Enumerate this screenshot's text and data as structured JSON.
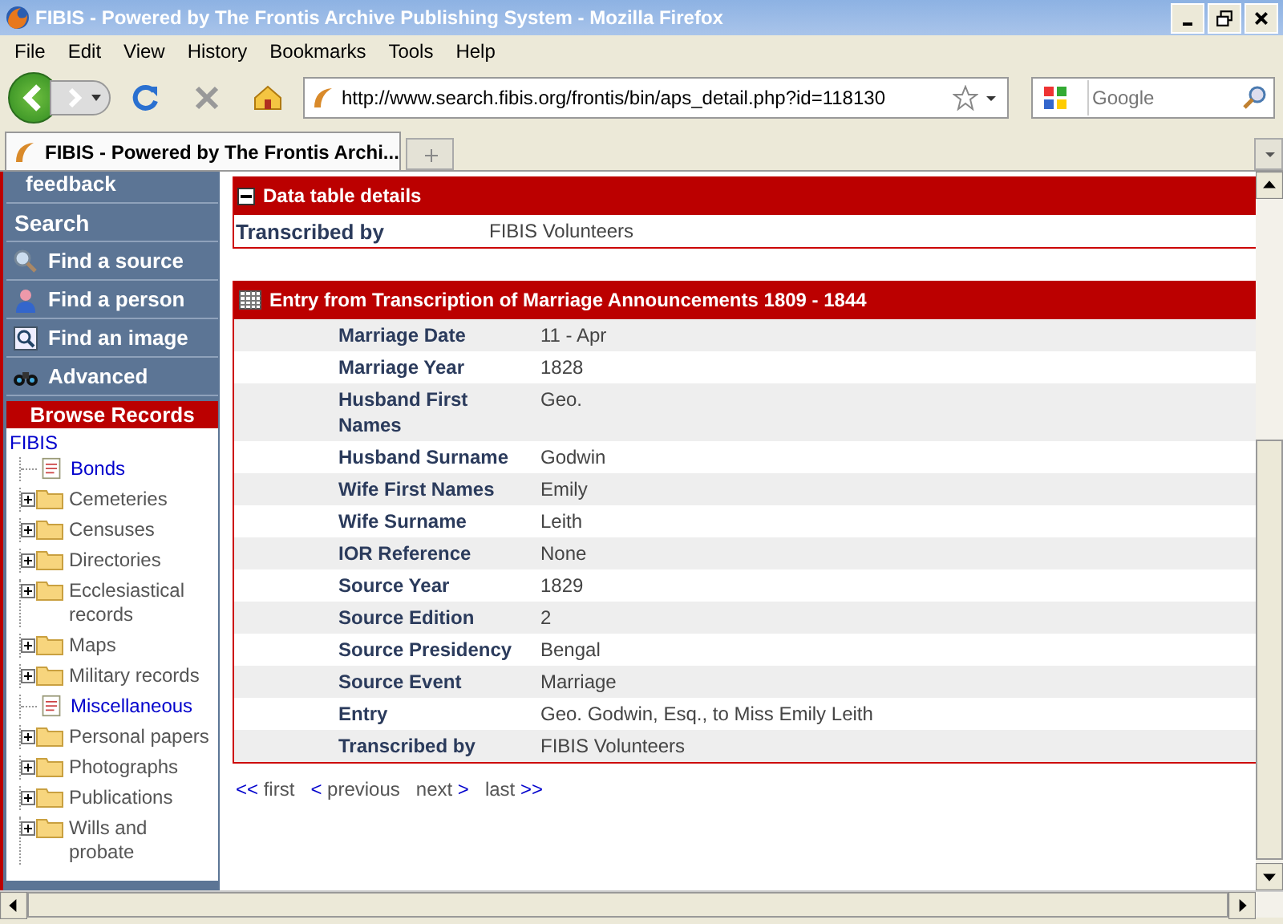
{
  "window": {
    "title": "FIBIS - Powered by The Frontis Archive Publishing System - Mozilla Firefox"
  },
  "menu": [
    "File",
    "Edit",
    "View",
    "History",
    "Bookmarks",
    "Tools",
    "Help"
  ],
  "address": {
    "value": "http://www.search.fibis.org/frontis/bin/aps_detail.php?id=118130"
  },
  "search": {
    "placeholder": "Google"
  },
  "tabs": [
    {
      "label": "FIBIS - Powered by The Frontis Archi...",
      "selected": true
    }
  ],
  "sidebar": {
    "top_link": "feedback",
    "search_heading": "Search",
    "search_items": [
      {
        "label": "Find a source",
        "kind": "magnifier"
      },
      {
        "label": "Find a person",
        "kind": "person"
      },
      {
        "label": "Find an image",
        "kind": "image"
      },
      {
        "label": "Advanced",
        "kind": "binoculars"
      }
    ],
    "browse_heading": "Browse Records",
    "root": "FIBIS",
    "items": [
      {
        "label": "Bonds",
        "kind": "document"
      },
      {
        "label": "Cemeteries",
        "kind": "folder"
      },
      {
        "label": "Censuses",
        "kind": "folder"
      },
      {
        "label": "Directories",
        "kind": "folder"
      },
      {
        "label": "Ecclesiastical records",
        "kind": "folder"
      },
      {
        "label": "Maps",
        "kind": "folder"
      },
      {
        "label": "Military records",
        "kind": "folder"
      },
      {
        "label": "Miscellaneous",
        "kind": "document"
      },
      {
        "label": "Personal papers",
        "kind": "folder"
      },
      {
        "label": "Photographs",
        "kind": "folder"
      },
      {
        "label": "Publications",
        "kind": "folder"
      },
      {
        "label": "Wills and probate",
        "kind": "folder"
      }
    ]
  },
  "details": {
    "title": "Data table details",
    "rows": [
      {
        "label": "Transcribed by",
        "value": "FIBIS Volunteers"
      }
    ]
  },
  "entry": {
    "title": "Entry from Transcription of Marriage Announcements 1809 - 1844",
    "rows": [
      {
        "label": "Marriage Date",
        "value": "11 - Apr"
      },
      {
        "label": "Marriage Year",
        "value": "1828"
      },
      {
        "label": "Husband First Names",
        "value": "Geo."
      },
      {
        "label": "Husband Surname",
        "value": "Godwin"
      },
      {
        "label": "Wife First Names",
        "value": "Emily"
      },
      {
        "label": "Wife Surname",
        "value": "Leith"
      },
      {
        "label": "IOR Reference",
        "value": "None"
      },
      {
        "label": "Source Year",
        "value": "1829"
      },
      {
        "label": "Source Edition",
        "value": "2"
      },
      {
        "label": "Source Presidency",
        "value": "Bengal"
      },
      {
        "label": "Source Event",
        "value": "Marriage"
      },
      {
        "label": "Entry",
        "value": "Geo. Godwin, Esq., to Miss Emily Leith"
      },
      {
        "label": "Transcribed by",
        "value": "FIBIS Volunteers"
      }
    ]
  },
  "pager": [
    {
      "arrow": "<<",
      "label": "first",
      "kind": "back"
    },
    {
      "arrow": "<",
      "label": "previous",
      "kind": "back"
    },
    {
      "arrow": ">",
      "label": "next",
      "kind": "forward"
    },
    {
      "arrow": ">>",
      "label": "last",
      "kind": "forward"
    }
  ]
}
